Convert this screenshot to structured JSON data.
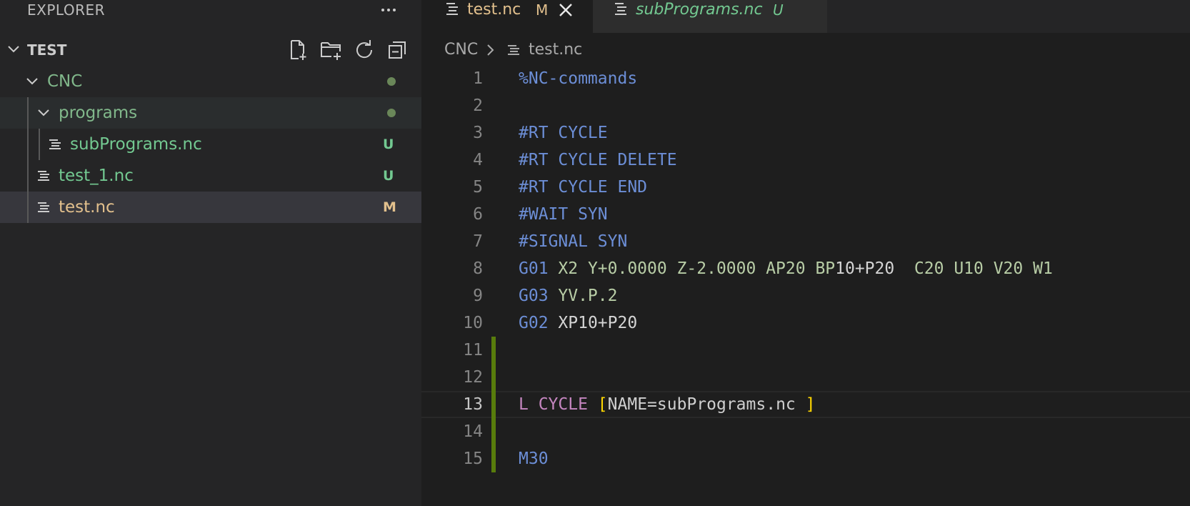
{
  "explorer": {
    "title": "EXPLORER",
    "section_title": "TEST",
    "actions": [
      "new-file-icon",
      "new-folder-icon",
      "refresh-icon",
      "collapse-all-icon"
    ],
    "tree": [
      {
        "label": "CNC",
        "type": "folder",
        "status": "dot"
      },
      {
        "label": "programs",
        "type": "folder",
        "status": "dot"
      },
      {
        "label": "subPrograms.nc",
        "type": "file",
        "badge": "U"
      },
      {
        "label": "test_1.nc",
        "type": "file",
        "badge": "U"
      },
      {
        "label": "test.nc",
        "type": "file",
        "badge": "M"
      }
    ]
  },
  "tabs": [
    {
      "label": "test.nc",
      "badge": "M",
      "active": true
    },
    {
      "label": "subPrograms.nc",
      "badge": "U",
      "active": false
    }
  ],
  "breadcrumb": {
    "folder": "CNC",
    "file": "test.nc"
  },
  "editor": {
    "current_line": 13,
    "lines": [
      {
        "n": "1",
        "tokens": [
          {
            "t": "%NC-commands",
            "c": "cmd"
          }
        ]
      },
      {
        "n": "2",
        "tokens": []
      },
      {
        "n": "3",
        "tokens": [
          {
            "t": "#RT CYCLE",
            "c": "cmd"
          }
        ]
      },
      {
        "n": "4",
        "tokens": [
          {
            "t": "#RT CYCLE DELETE",
            "c": "cmd"
          }
        ]
      },
      {
        "n": "5",
        "tokens": [
          {
            "t": "#RT CYCLE END",
            "c": "cmd"
          }
        ]
      },
      {
        "n": "6",
        "tokens": [
          {
            "t": "#WAIT SYN",
            "c": "cmd"
          }
        ]
      },
      {
        "n": "7",
        "tokens": [
          {
            "t": "#SIGNAL SYN",
            "c": "cmd"
          }
        ]
      },
      {
        "n": "8",
        "tokens": [
          {
            "t": "G01",
            "c": "cmd"
          },
          {
            "t": " X2 ",
            "c": "arg"
          },
          {
            "t": "Y+0.0000",
            "c": "arg"
          },
          {
            "t": " Z-2.0000 ",
            "c": "arg"
          },
          {
            "t": "AP20",
            "c": "arg"
          },
          {
            "t": " BP",
            "c": "arg"
          },
          {
            "t": "10+P20",
            "c": "white"
          },
          {
            "t": "  C20 U10 V20 W1",
            "c": "arg"
          }
        ]
      },
      {
        "n": "9",
        "tokens": [
          {
            "t": "G03",
            "c": "cmd"
          },
          {
            "t": " YV.P.2",
            "c": "arg"
          }
        ]
      },
      {
        "n": "10",
        "tokens": [
          {
            "t": "G02",
            "c": "cmd"
          },
          {
            "t": " XP",
            "c": "white"
          },
          {
            "t": "10+P20",
            "c": "white"
          }
        ]
      },
      {
        "n": "11",
        "tokens": []
      },
      {
        "n": "12",
        "tokens": []
      },
      {
        "n": "13",
        "tokens": [
          {
            "t": "L",
            "c": "kw"
          },
          {
            "t": " CYCLE ",
            "c": "kw"
          },
          {
            "t": "[",
            "c": "bracket"
          },
          {
            "t": "NAME=",
            "c": "name"
          },
          {
            "t": "subPrograms.nc ",
            "c": "word"
          },
          {
            "t": "]",
            "c": "bracket"
          }
        ]
      },
      {
        "n": "14",
        "tokens": []
      },
      {
        "n": "15",
        "tokens": [
          {
            "t": "M30",
            "c": "cmd"
          }
        ]
      }
    ]
  },
  "colors": {
    "git_untracked": "#73c991",
    "git_modified": "#e2c08d",
    "gutter_added": "#587c0c",
    "folder_text": "#81b88b"
  }
}
